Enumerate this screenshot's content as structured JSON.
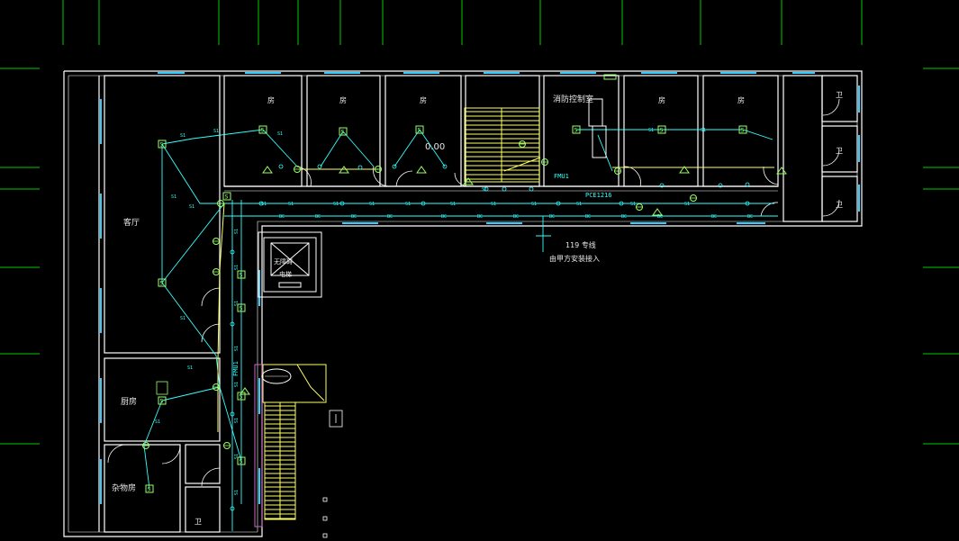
{
  "colors": {
    "background": "#000000",
    "walls": "#ffffff",
    "grid": "#00cc00",
    "wiring": "#33ffff",
    "devices": "#99ff66",
    "stairs": "#ffff66",
    "windows": "#33ccff",
    "hatch": "#cc66cc"
  },
  "rooms": {
    "r1": "房",
    "r2": "房",
    "r3": "房",
    "control": "消防控制室",
    "r5": "房",
    "r6": "房",
    "wc1": "卫",
    "wc2": "卫",
    "wc3": "卫",
    "hall": "客厅",
    "kitchen": "厨房",
    "storage": "杂物房",
    "wc4": "卫",
    "lift_line1": "无障碍",
    "lift_line2": "电梯"
  },
  "labels": {
    "elevation": "0.00",
    "fmu": "FMU1",
    "pcp": "PCE1216",
    "fire_line": "119 专线",
    "fire_line2": "由甲方安装接入",
    "fmu_vertical": "FMU1",
    "wire_s1": "S1",
    "wire_bc": "BC",
    "wire_f": "F"
  },
  "icons": {
    "smoke": "smoke-detector-icon",
    "alarm": "alarm-bell-icon",
    "heat": "heat-detector-icon",
    "control_panel": "control-panel-icon"
  }
}
